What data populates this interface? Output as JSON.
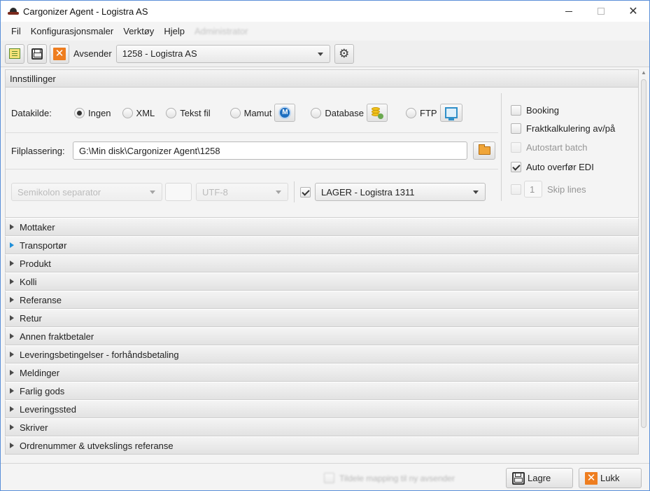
{
  "window": {
    "title": "Cargonizer Agent - Logistra AS",
    "min_glyph": "—",
    "max_glyph": "☐",
    "close_glyph": "✕"
  },
  "menu": {
    "items": [
      "Fil",
      "Konfigurasjonsmaler",
      "Verktøy",
      "Hjelp",
      "Administrator"
    ]
  },
  "toolbar": {
    "sender_label": "Avsender",
    "sender_value": "1258 - Logistra AS"
  },
  "settings": {
    "header": "Innstillinger",
    "datakilde_label": "Datakilde:",
    "sources": [
      {
        "label": "Ingen",
        "checked": true
      },
      {
        "label": "XML",
        "checked": false
      },
      {
        "label": "Tekst fil",
        "checked": false
      },
      {
        "label": "Mamut",
        "checked": false
      },
      {
        "label": "Database",
        "checked": false
      },
      {
        "label": "FTP",
        "checked": false
      }
    ],
    "mamut_icon_letter": "M",
    "file_location_label": "Filplassering:",
    "file_location_value": "G:\\Min disk\\Cargonizer Agent\\1258",
    "separator_value": "Semikolon separator",
    "small_field_value": "",
    "encoding_value": "UTF-8",
    "lager_value": "LAGER - Logistra 1311",
    "options": [
      {
        "label": "Booking",
        "checked": false,
        "disabled": false
      },
      {
        "label": "Fraktkalkulering av/på",
        "checked": false,
        "disabled": false
      },
      {
        "label": "Autostart batch",
        "checked": false,
        "disabled": true
      },
      {
        "label": "Auto overfør EDI",
        "checked": true,
        "disabled": false
      }
    ],
    "skip_lines_value": "1",
    "skip_lines_label": "Skip lines"
  },
  "sections": [
    "Mottaker",
    "Transportør",
    "Produkt",
    "Kolli",
    "Referanse",
    "Retur",
    "Annen fraktbetaler",
    "Leveringsbetingelser - forhåndsbetaling",
    "Meldinger",
    "Farlig gods",
    "Leveringssted",
    "Skriver",
    "Ordrenummer & utvekslings referanse"
  ],
  "footer": {
    "blurred_option": "Tildele mapping til ny avsender",
    "save_label": "Lagre",
    "close_label": "Lukk"
  },
  "colors": {
    "accent": "#ee7d1f",
    "highlight_arrow": "#1f8fd9"
  }
}
